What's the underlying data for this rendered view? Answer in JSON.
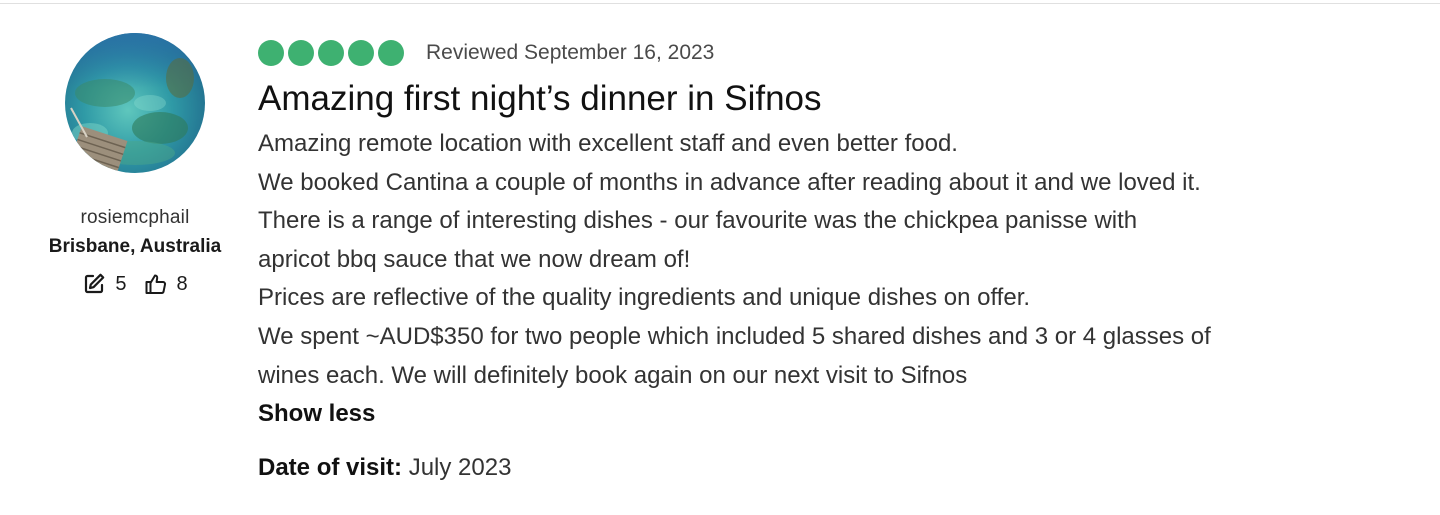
{
  "reviewer": {
    "username": "rosiemcphail",
    "location": "Brisbane, Australia",
    "contributions_icon": "edit-icon",
    "contributions": "5",
    "helpful_icon": "thumbs-up-icon",
    "helpful_votes": "8"
  },
  "review": {
    "rating": 5,
    "rating_max": 5,
    "bubble_color": "#3eb171",
    "reviewed_date": "Reviewed September 16, 2023",
    "title": "Amazing first night’s dinner in Sifnos",
    "lines": [
      "Amazing remote location with excellent staff and even better food.",
      "We booked Cantina a couple of months in advance after reading about it and we loved it.",
      "There is a range of interesting dishes - our favourite was the chickpea panisse with",
      "apricot bbq sauce that we now dream of!",
      "Prices are reflective of the quality ingredients and unique dishes on offer.",
      "We spent ~AUD$350 for two people which included 5 shared dishes and 3 or 4 glasses of",
      "wines each. We will definitely book again on our next visit to Sifnos"
    ],
    "show_less_label": "Show less",
    "visit_label": "Date of visit:",
    "visit_value": "July 2023"
  }
}
